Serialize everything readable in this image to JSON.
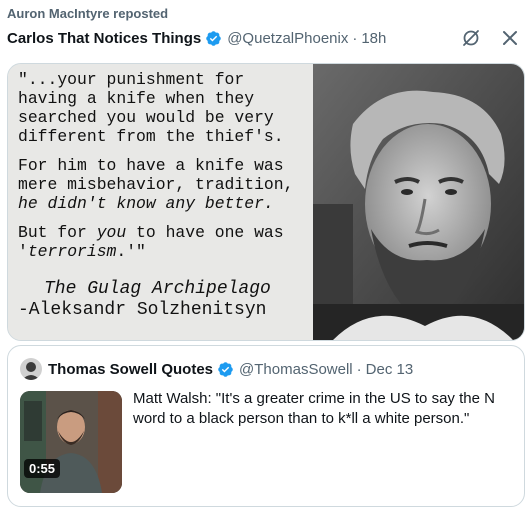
{
  "repost": {
    "text": "Auron MacIntyre reposted"
  },
  "tweet": {
    "author_name": "Carlos That Notices Things",
    "handle": "@QuetzalPhoenix",
    "separator": "·",
    "time": "18h",
    "icons": [
      "verified-badge-icon",
      "grok-icon",
      "close-icon"
    ]
  },
  "quote_image": {
    "lines": [
      "\"...your punishment for",
      "having a knife when they",
      "searched you would be very",
      "different from the thief's.",
      "For him to have a knife was",
      "mere misbehavior, tradition,"
    ],
    "line7_italic": "he didn't know any better.",
    "line8_pre": "But for ",
    "line8_italic": "you",
    "line8_post": " to have one was",
    "line9_pre": "'",
    "line9_italic": "terrorism",
    "line9_post": ".'\"",
    "book": "The Gulag Archipelago",
    "author": "-Aleksandr Solzhenitsyn"
  },
  "quoted": {
    "author_name": "Thomas Sowell Quotes",
    "handle": "@ThomasSowell",
    "separator": "·",
    "time": "Dec 13",
    "text": "Matt Walsh: \"It's a greater crime in the US to say the N word to a black person than to k*ll a white person.\"",
    "video_duration": "0:55"
  },
  "colors": {
    "verified": "#1d9bf0",
    "secondary_text": "#536471",
    "border": "#cfd9de"
  }
}
